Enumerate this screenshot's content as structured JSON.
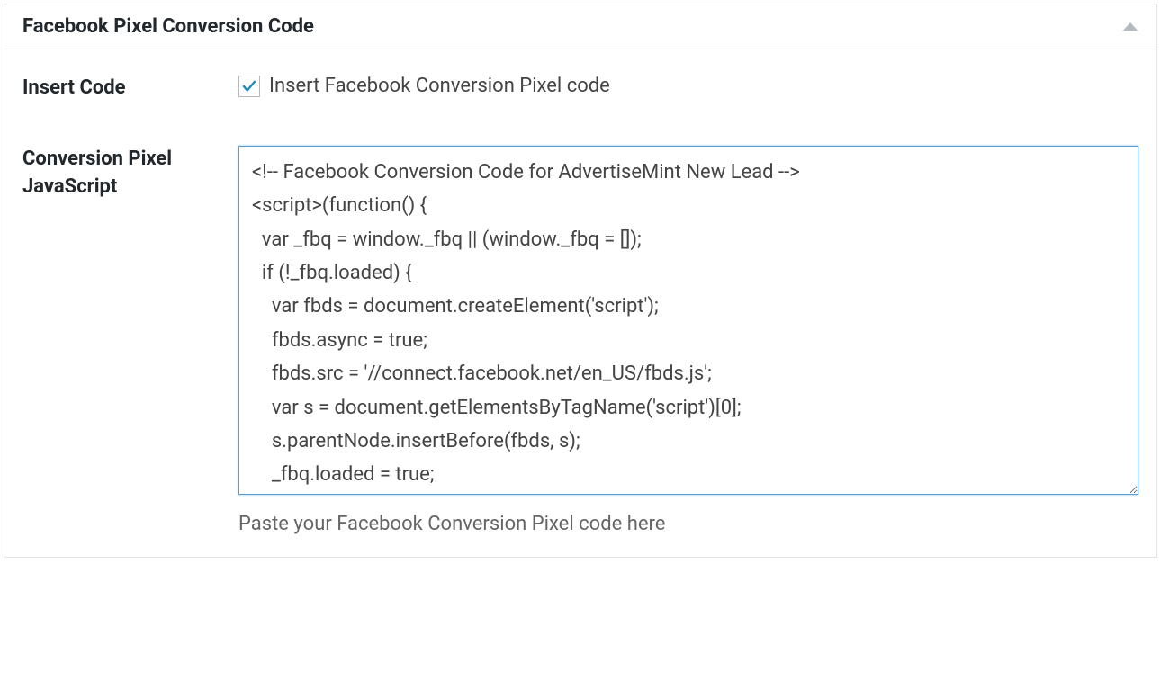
{
  "panel": {
    "title": "Facebook Pixel Conversion Code"
  },
  "insert_code": {
    "label": "Insert Code",
    "checkbox_label": "Insert Facebook Conversion Pixel code",
    "checked": true
  },
  "conversion_pixel": {
    "label": "Conversion Pixel JavaScript",
    "code": "<!-- Facebook Conversion Code for AdvertiseMint New Lead -->\n<script>(function() {\n  var _fbq = window._fbq || (window._fbq = []);\n  if (!_fbq.loaded) {\n    var fbds = document.createElement('script');\n    fbds.async = true;\n    fbds.src = '//connect.facebook.net/en_US/fbds.js';\n    var s = document.getElementsByTagName('script')[0];\n    s.parentNode.insertBefore(fbds, s);\n    _fbq.loaded = true;",
    "help_text": "Paste your Facebook Conversion Pixel code here"
  }
}
